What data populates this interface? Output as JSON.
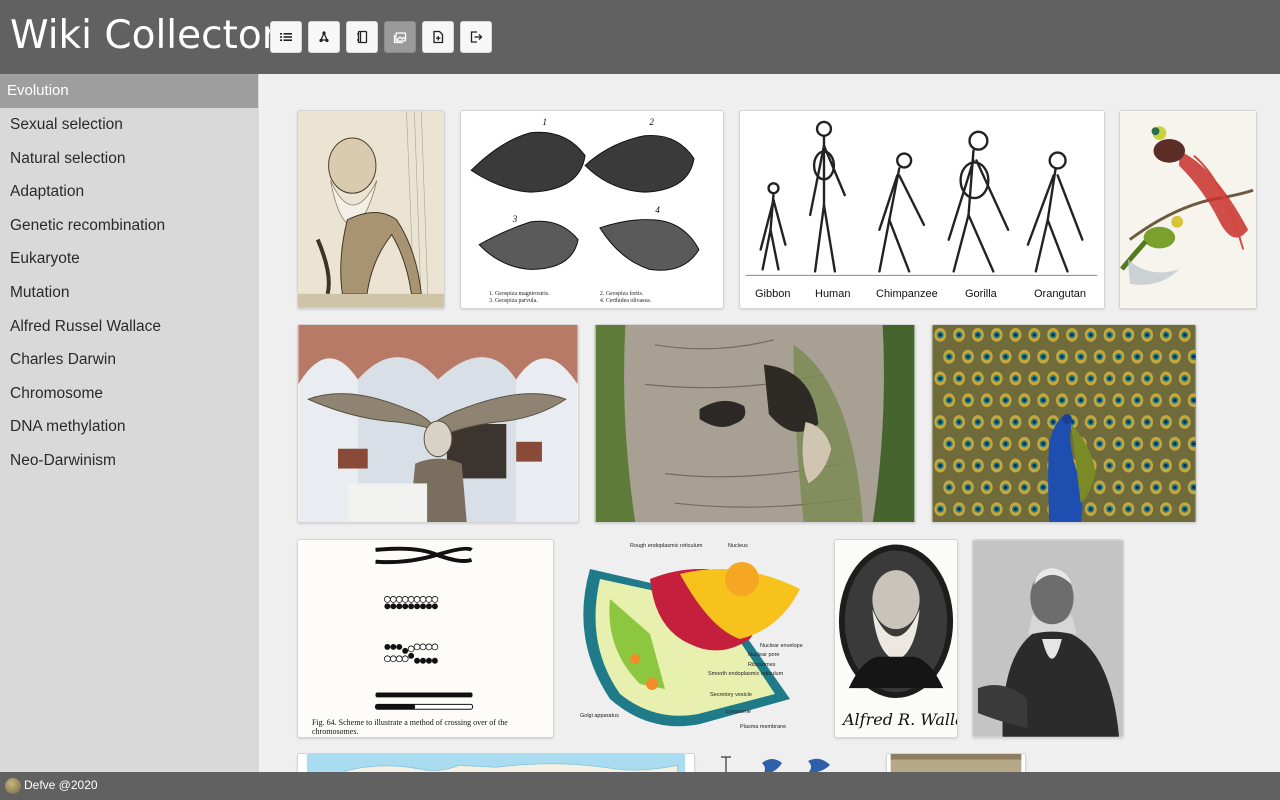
{
  "app": {
    "title": "Wiki Collector"
  },
  "colors": {
    "header": "#616161",
    "sidebar": "#d9d9d9",
    "nav_active": "#9e9e9e",
    "main": "#efefef"
  },
  "toolbar": [
    {
      "icon": "list-icon"
    },
    {
      "icon": "graph-icon"
    },
    {
      "icon": "book-icon"
    },
    {
      "icon": "gallery-icon",
      "active": true
    },
    {
      "icon": "add-page-icon"
    },
    {
      "icon": "export-icon"
    }
  ],
  "sidebar": {
    "title": "Evolution",
    "items": [
      "Sexual selection",
      "Natural selection",
      "Adaptation",
      "Genetic recombination",
      "Eukaryote",
      "Mutation",
      "Alfred Russel Wallace",
      "Charles Darwin",
      "Chromosome",
      "DNA methylation",
      "Neo-Darwinism"
    ]
  },
  "gallery": {
    "images": [
      {
        "name": "darwin-ape-caricature"
      },
      {
        "name": "darwin-finches-drawing",
        "labels": [
          "1",
          "2",
          "3",
          "4",
          "1. Geospiza magnirostris.",
          "2. Geospiza fortis.",
          "3. Geospiza parvula.",
          "4. Certhidea olivasea."
        ]
      },
      {
        "name": "primate-skeletons",
        "labels": [
          "Gibbon",
          "Human",
          "Chimpanzee",
          "Gorilla",
          "Orangutan"
        ]
      },
      {
        "name": "birds-of-paradise-illustration"
      },
      {
        "name": "irish-elk-skeleton"
      },
      {
        "name": "peppered-moths-on-bark"
      },
      {
        "name": "peacock-display"
      },
      {
        "name": "chromosome-crossing-over-figure",
        "caption": "Fig. 64. Scheme to illustrate a method of crossing over of the chromosomes."
      },
      {
        "name": "eukaryotic-cell-diagram",
        "labels": [
          "Rough endoplasmic reticulum",
          "Nucleus",
          "Nuclear envelope",
          "Nuclear pore",
          "Ribosomes",
          "Smooth endoplasmic reticulum",
          "Golgi apparatus",
          "Secretory vesicle",
          "Lysosome",
          "Plasma membrane"
        ]
      },
      {
        "name": "alfred-russel-wallace-portrait",
        "signature": "Alfred R. Wallace"
      },
      {
        "name": "charles-darwin-photo"
      },
      {
        "name": "world-map-partial"
      },
      {
        "name": "leaf-diagram-partial"
      },
      {
        "name": "sepia-photo-partial"
      }
    ]
  },
  "footer": {
    "text": "Defve @2020"
  }
}
